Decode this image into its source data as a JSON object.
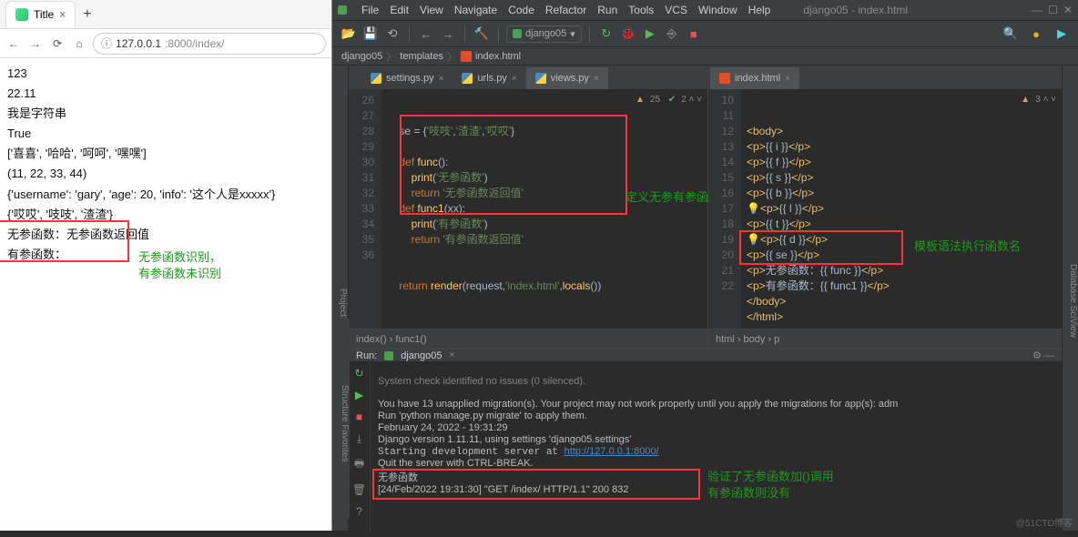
{
  "browser": {
    "tab_title": "Title",
    "url_prefix": "127.0.0.1",
    "url_path": ":8000/index/",
    "lines": [
      "123",
      "22.11",
      "我是字符串",
      "True",
      "['喜喜', '哈哈', '呵呵', '嘿嘿']",
      "(11, 22, 33, 44)",
      "{'username': 'gary', 'age': 20, 'info': '这个人是xxxxx'}",
      "{'哎哎', '吱吱', '渣渣'}",
      "无参函数：无参函数返回值",
      "有参函数："
    ],
    "note": "无参函数识别，\n有参函数未识别"
  },
  "ide": {
    "project_title": "django05 - index.html",
    "menus": [
      "File",
      "Edit",
      "View",
      "Navigate",
      "Code",
      "Refactor",
      "Run",
      "Tools",
      "VCS",
      "Window",
      "Help"
    ],
    "run_config": "django05",
    "crumbs": [
      "django05",
      "templates",
      "index.html"
    ],
    "left_tabs": [
      {
        "label": "settings.py",
        "icon": "py"
      },
      {
        "label": "urls.py",
        "icon": "py"
      },
      {
        "label": "views.py",
        "icon": "py",
        "active": true
      }
    ],
    "right_tabs": [
      {
        "label": "index.html",
        "icon": "html",
        "active": true
      }
    ],
    "left_inspect": "▲ 25  ✔ 2  ˄ ˅",
    "right_inspect": "▲ 3  ˄ ˅",
    "left_gutter": [
      26,
      27,
      28,
      29,
      30,
      31,
      32,
      33,
      34,
      35,
      36
    ],
    "right_gutter": [
      10,
      11,
      12,
      13,
      14,
      15,
      16,
      17,
      18,
      19,
      20,
      21,
      22
    ],
    "left_note": "定义无参有参函数",
    "right_note": "模板语法执行函数名",
    "left_bcrumb": "index()  ›  func1()",
    "right_bcrumb": "html  ›  body  ›  p",
    "left_code_lines": [
      "    se = {'吱吱','渣渣','哎哎'}",
      "",
      "    def func():",
      "        print('无参函数')",
      "        return '无参函数返回值'",
      "    def func1(xx):",
      "        print('有参函数')",
      "        return '有参函数返回值'",
      "",
      "",
      "    return render(request,'index.html',locals())"
    ],
    "right_code_lines": [
      "<body>",
      "<p>{{ i }}</p>",
      "<p>{{ f }}</p>",
      "<p>{{ s }}</p>",
      "<p>{{ b }}</p>",
      "<p>{{ l }}</p>",
      "<p>{{ t }}</p>",
      "<p>{{ d }}</p>",
      "<p>{{ se }}</p>",
      "<p>无参函数：{{ func }}</p>",
      "<p>有参函数：{{ func1 }}</p>",
      "</body>",
      "</html>"
    ],
    "run": {
      "title": "Run:",
      "config": "django05",
      "lines": [
        "System check identified no issues (0 silenced).",
        "",
        "You have 13 unapplied migration(s). Your project may not work properly until you apply the migrations for app(s): adm",
        "Run 'python manage.py migrate' to apply them.",
        "February 24, 2022 - 19:31:29",
        "Django version 1.11.11, using settings 'django05.settings'",
        "Starting development server at http://127.0.0.1:8000/",
        "Quit the server with CTRL-BREAK.",
        "无参函数",
        "[24/Feb/2022 19:31:30] \"GET /index/ HTTP/1.1\" 200 832"
      ],
      "note": "验证了无参函数加()调用\n有参函数则没有",
      "link": "http://127.0.0.1:8000/"
    },
    "side_left": [
      "Project",
      "Structure",
      "Favorites"
    ],
    "side_right": [
      "Database",
      "SciView"
    ]
  },
  "watermark": "@51CTO博客"
}
